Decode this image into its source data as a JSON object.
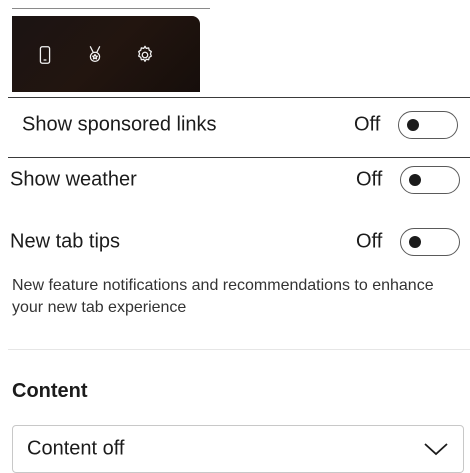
{
  "preview_icons": [
    "phone-icon",
    "trophy-icon",
    "gear-icon"
  ],
  "settings": {
    "sponsored_links": {
      "label": "Show sponsored links",
      "state": "Off"
    },
    "weather": {
      "label": "Show weather",
      "state": "Off"
    },
    "new_tab_tips": {
      "label": "New tab tips",
      "state": "Off",
      "description": "New feature notifications and recommendations to enhance your new tab experience"
    }
  },
  "content_section": {
    "heading": "Content",
    "select_value": "Content off"
  }
}
